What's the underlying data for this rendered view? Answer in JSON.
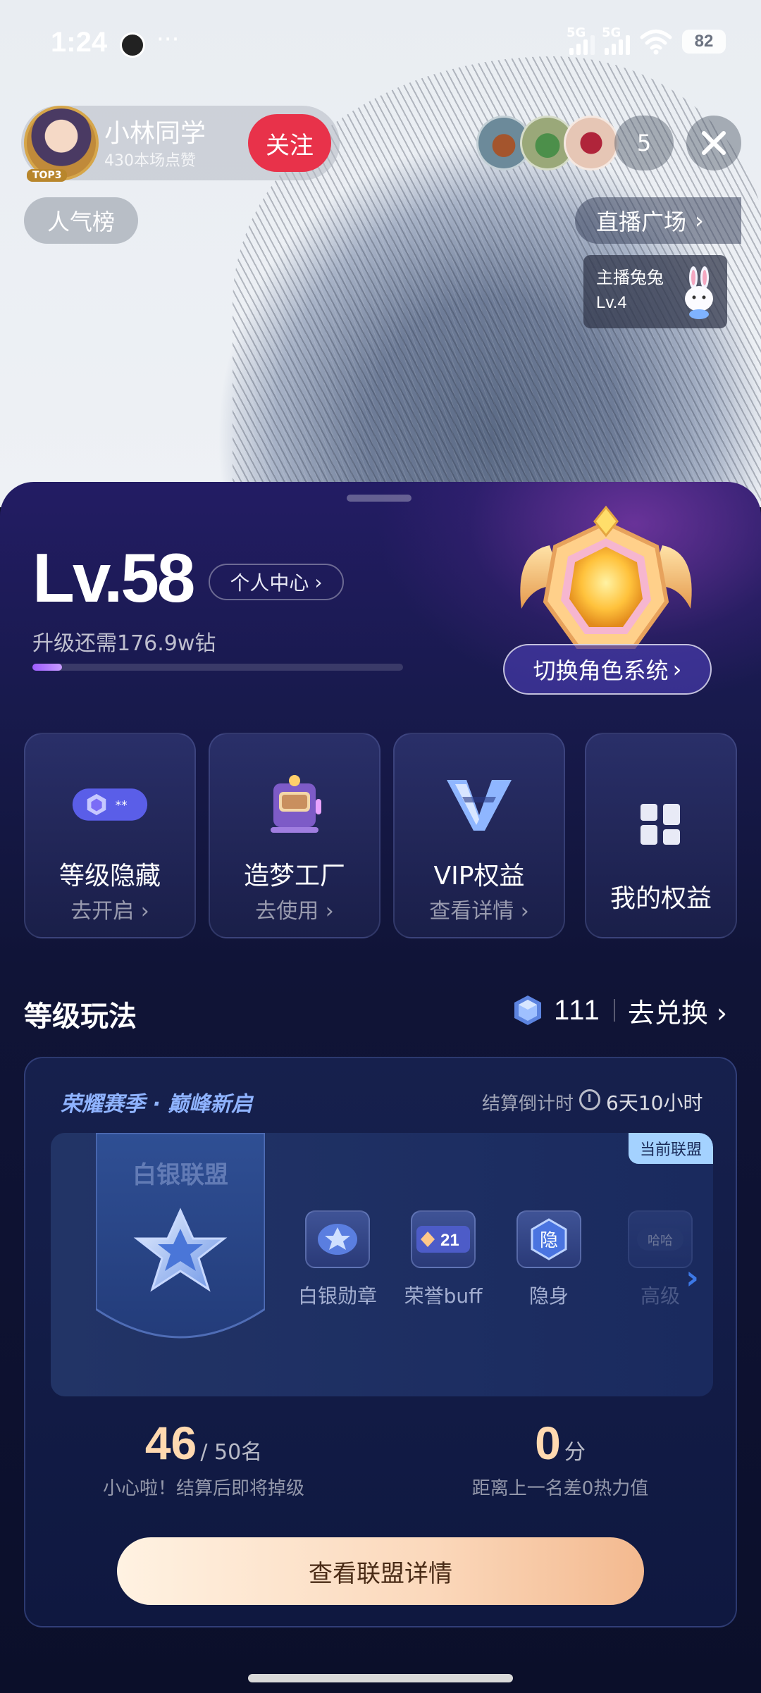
{
  "status_bar": {
    "time": "1:24",
    "more": "···",
    "sim1_label": "5G",
    "sim2_label": "5G",
    "battery": "82"
  },
  "host": {
    "name": "小林同学",
    "likes": "430本场点赞",
    "follow_label": "关注",
    "avatar_badge": "TOP3"
  },
  "viewers": {
    "count": "5"
  },
  "close_icon": "close-icon",
  "rank_label": "人气榜",
  "plaza_label": "直播广场",
  "host_rabbit": {
    "title": "主播兔兔",
    "level": "Lv.4"
  },
  "level_panel": {
    "level": "Lv.58",
    "personal_center": "个人中心",
    "upgrade_text": "升级还需176.9w钻",
    "progress_fraction": 0.08,
    "switch_role": "切换角色系统"
  },
  "cards": [
    {
      "name": "等级隐藏",
      "sub": "去开启",
      "icon": "level-hide-icon"
    },
    {
      "name": "造梦工厂",
      "sub": "去使用",
      "icon": "dream-factory-icon"
    },
    {
      "name": "VIP权益",
      "sub": "查看详情",
      "icon": "vip-icon"
    },
    {
      "name": "我的权益",
      "sub": "",
      "icon": "grid-icon"
    }
  ],
  "section": {
    "title": "等级玩法",
    "gems": "111",
    "exchange": "去兑换"
  },
  "season": {
    "title": "荣耀赛季 · 巅峰新启",
    "countdown_label": "结算倒计时",
    "countdown_value": "6天10小时",
    "current_tag": "当前联盟",
    "league_name": "白银联盟",
    "perks": [
      {
        "label": "白银勋章",
        "badge": ""
      },
      {
        "label": "荣誉buff",
        "badge": "21"
      },
      {
        "label": "隐身",
        "badge": "隐"
      },
      {
        "label": "高级",
        "badge": "哈哈"
      }
    ],
    "rank_value": "46",
    "rank_total": "/ 50名",
    "rank_note": "小心啦！结算后即将掉级",
    "score_value": "0",
    "score_unit": "分",
    "score_note": "距离上一名差0热力值",
    "detail_button": "查看联盟详情"
  },
  "colors": {
    "follow": "#e8324a",
    "accent_purple": "#9d5cff",
    "button_peach": "#fbd8bb"
  }
}
